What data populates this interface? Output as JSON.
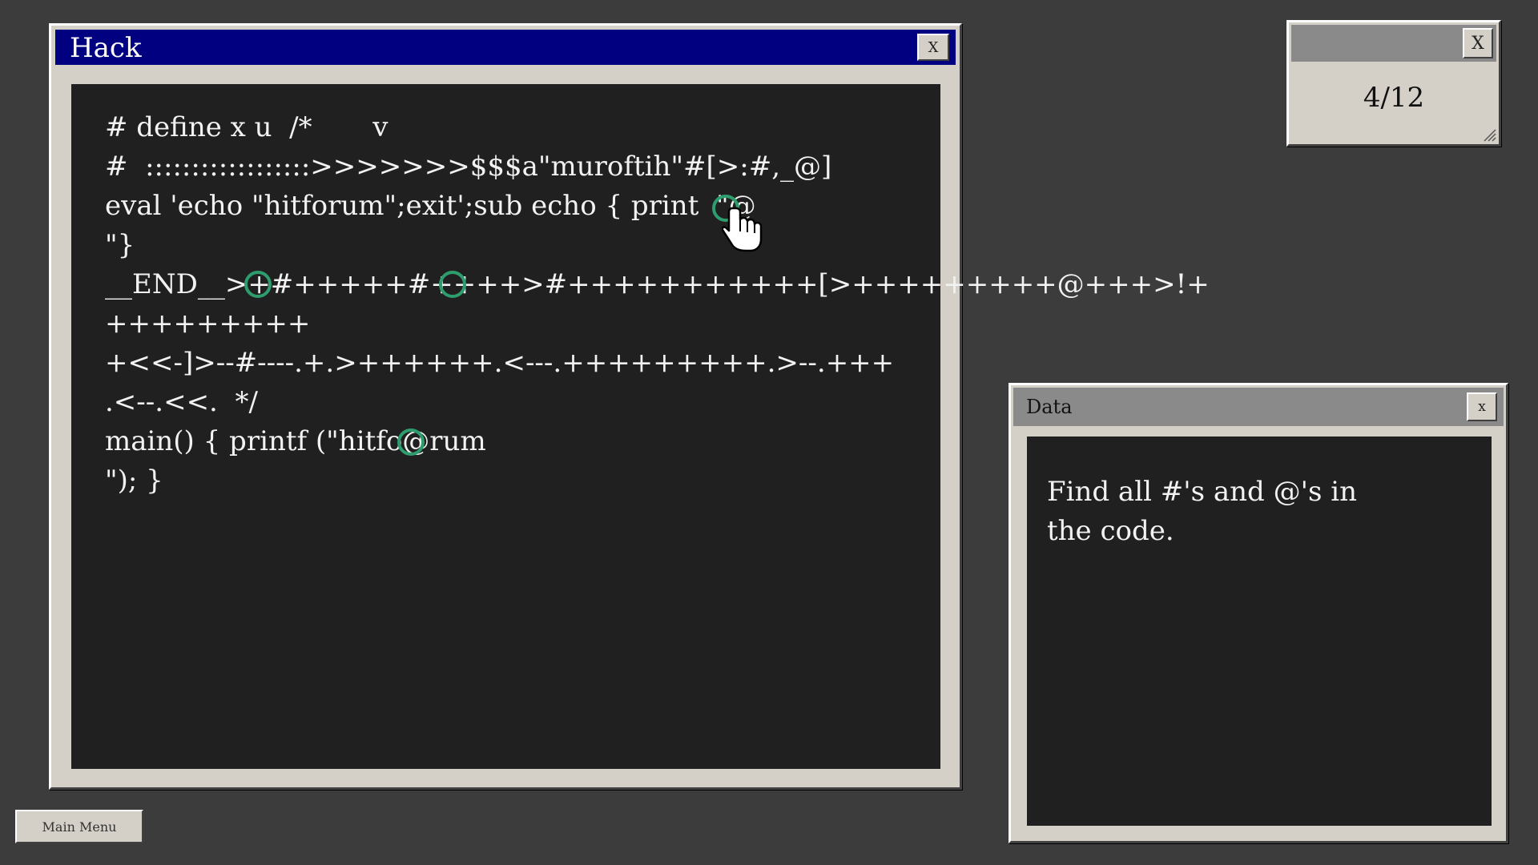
{
  "hack_window": {
    "title": "Hack",
    "close_label": "X",
    "code_lines": [
      "# define x u  /*       v",
      "#  ::::::::::::::::::>>>>>>>$$$a\"muroftih\"#[>:#,_@]",
      "eval 'echo \"hitforum\";exit';sub echo { print  \"@",
      "\"}",
      "__END__>+#+++++#++++>#+++++++++++[>+++++++++@+++>!+",
      "+++++++++",
      "+<<-]>--#----.+.>++++++.<---.+++++++++.>--.+++",
      ".<--.<<.  */",
      "main() { printf (\"hitfo@rum",
      "\"); }"
    ]
  },
  "counter_window": {
    "close_label": "X",
    "progress_text": "4/12",
    "found": 4,
    "total": 12
  },
  "data_window": {
    "title": "Data",
    "close_label": "x",
    "instructions": "Find all #'s and @'s in the code."
  },
  "main_menu": {
    "label": "Main Menu"
  },
  "colors": {
    "desktop": "#3c3c3c",
    "hack_titlebar": "#000080",
    "panel": "#202020",
    "marker": "#2e9d6e",
    "window_face": "#d4d0c8"
  },
  "icons": {
    "cursor": "hand-pointer-icon",
    "found_marker": "circle-marker-icon",
    "resize": "resize-grip-icon"
  }
}
